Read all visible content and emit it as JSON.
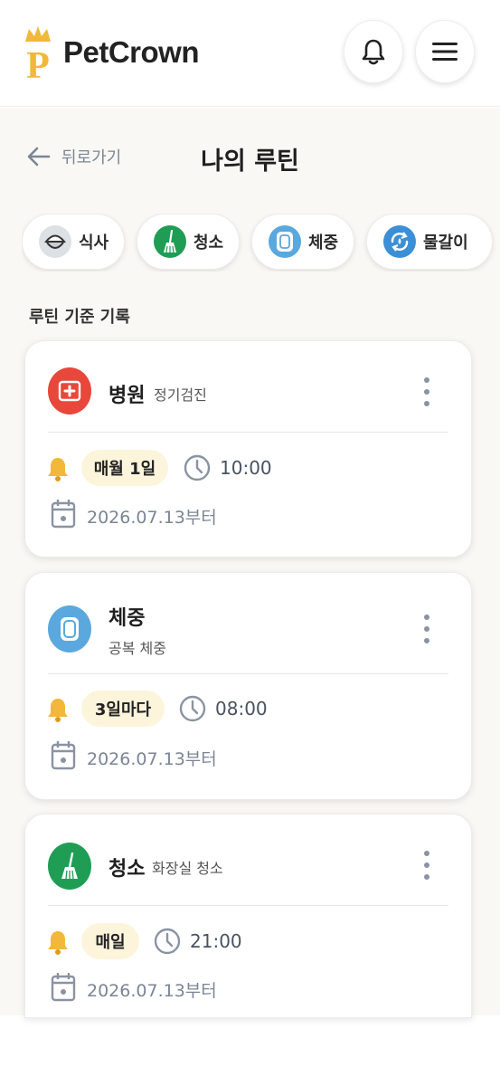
{
  "header": {
    "brand": "PetCrown",
    "logo_letter": "P",
    "icons": {
      "notifications": "bell-icon",
      "menu": "menu-icon"
    }
  },
  "nav": {
    "back_label": "뒤로가기",
    "page_title": "나의 루틴"
  },
  "tabs": [
    {
      "label": "식사",
      "icon": "food-bowl-icon",
      "color": "#dde1e5"
    },
    {
      "label": "청소",
      "icon": "broom-icon",
      "color": "#1f9d55"
    },
    {
      "label": "체중",
      "icon": "scale-icon",
      "color": "#5aa8de"
    },
    {
      "label": "물갈이",
      "icon": "water-change-icon",
      "color": "#3b8fd6"
    }
  ],
  "section_label": "루틴 기준 기록",
  "routines": [
    {
      "title": "병원",
      "subtitle": "정기검진",
      "icon": "hospital-icon",
      "icon_color": "#e8473b",
      "frequency": "매월 1일",
      "time": "10:00",
      "since": "2026.07.13부터"
    },
    {
      "title": "체중",
      "subtitle": "공복 체중",
      "icon": "scale-icon",
      "icon_color": "#5aa8de",
      "frequency": "3일마다",
      "time": "08:00",
      "since": "2026.07.13부터"
    },
    {
      "title": "청소",
      "subtitle": "화장실 청소",
      "icon": "broom-icon",
      "icon_color": "#1f9d55",
      "frequency": "매일",
      "time": "21:00",
      "since": "2026.07.13부터"
    }
  ],
  "colors": {
    "accent_gold": "#f2b83a",
    "pill_bg": "#fdf4dc",
    "page_bg": "#f9f8f4"
  }
}
